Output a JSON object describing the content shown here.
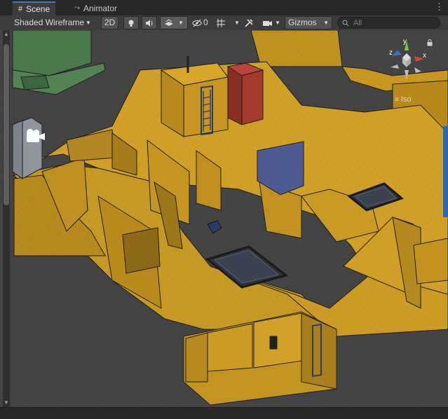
{
  "tabs": [
    {
      "label": "Scene",
      "icon": "grid-icon",
      "active": true
    },
    {
      "label": "Animator",
      "icon": "animator-icon",
      "active": false
    }
  ],
  "toolbar": {
    "draw_mode": "Shaded Wireframe",
    "mode_2d": "2D",
    "hidden_count": "0",
    "gizmos": "Gizmos",
    "search_placeholder": "All"
  },
  "orientation": {
    "projection": "Iso",
    "axis_y": "y",
    "axis_z": "z",
    "axis_x": "x"
  },
  "colors": {
    "accent": "#3a79bb",
    "floor": "#d1a027",
    "red_block": "#a53a2e",
    "blue_block": "#4e5b93",
    "green_block": "#4a7a4c",
    "grey_block": "#8f959c"
  }
}
